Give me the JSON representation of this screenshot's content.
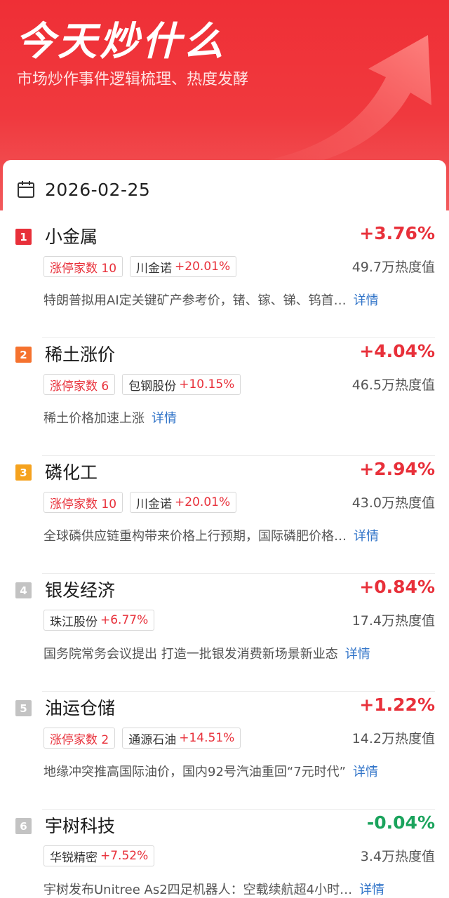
{
  "header": {
    "title": "今天炒什么",
    "subtitle": "市场炒作事件逻辑梳理、热度发酵"
  },
  "date": "2026-02-25",
  "colors": {
    "up": "#e8303a",
    "down": "#1aa35c",
    "link": "#2f73c8"
  },
  "detail_label": "详情",
  "items": [
    {
      "rank": "1",
      "rank_color": "#e8303a",
      "name": "小金属",
      "change": "+3.76%",
      "direction": "up",
      "limit_tag": "涨停家数 10",
      "stock": "川金诺",
      "stock_change": "+20.01%",
      "heat": "49.7万热度值",
      "desc": "特朗普拟用AI定关键矿产参考价，锗、镓、锑、钨首…"
    },
    {
      "rank": "2",
      "rank_color": "#f5722e",
      "name": "稀土涨价",
      "change": "+4.04%",
      "direction": "up",
      "limit_tag": "涨停家数 6",
      "stock": "包钢股份",
      "stock_change": "+10.15%",
      "heat": "46.5万热度值",
      "desc": "稀土价格加速上涨"
    },
    {
      "rank": "3",
      "rank_color": "#f5a21e",
      "name": "磷化工",
      "change": "+2.94%",
      "direction": "up",
      "limit_tag": "涨停家数 10",
      "stock": "川金诺",
      "stock_change": "+20.01%",
      "heat": "43.0万热度值",
      "desc": "全球磷供应链重构带来价格上行预期，国际磷肥价格…"
    },
    {
      "rank": "4",
      "rank_color": "#c3c3c3",
      "name": "银发经济",
      "change": "+0.84%",
      "direction": "up",
      "limit_tag": "",
      "stock": "珠江股份",
      "stock_change": "+6.77%",
      "heat": "17.4万热度值",
      "desc": "国务院常务会议提出 打造一批银发消费新场景新业态"
    },
    {
      "rank": "5",
      "rank_color": "#c3c3c3",
      "name": "油运仓储",
      "change": "+1.22%",
      "direction": "up",
      "limit_tag": "涨停家数 2",
      "stock": "通源石油",
      "stock_change": "+14.51%",
      "heat": "14.2万热度值",
      "desc": "地缘冲突推高国际油价，国内92号汽油重回“7元时代”"
    },
    {
      "rank": "6",
      "rank_color": "#c3c3c3",
      "name": "宇树科技",
      "change": "-0.04%",
      "direction": "down",
      "limit_tag": "",
      "stock": "华锐精密",
      "stock_change": "+7.52%",
      "heat": "3.4万热度值",
      "desc": "宇树发布Unitree As2四足机器人：空载续航超4小时…"
    }
  ]
}
